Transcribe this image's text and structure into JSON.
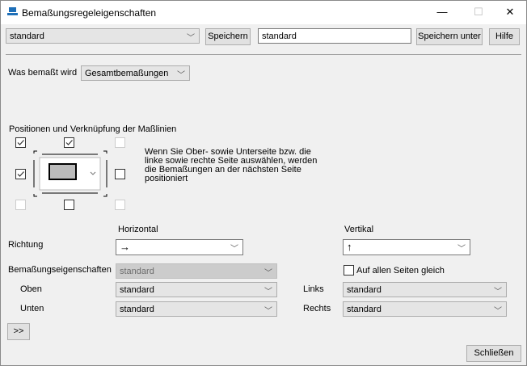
{
  "window": {
    "title": "Bemaßungsregeleigenschaften",
    "minimize": "—",
    "maximize": "☐",
    "close": "✕"
  },
  "top": {
    "preset": "standard",
    "save": "Speichern",
    "name_value": "standard",
    "save_as": "Speichern unter",
    "help": "Hilfe"
  },
  "what": {
    "label": "Was bemaßt wird",
    "value": "Gesamtbemaßungen"
  },
  "positions": {
    "label": "Positionen und Verknüpfung der Maßlinien",
    "hint": "Wenn Sie Ober- sowie Unterseite bzw. die linke sowie rechte Seite auswählen, werden die Bemaßungen an der nächsten Seite positioniert",
    "checks": {
      "top_left": true,
      "top": true,
      "top_right": false,
      "left": true,
      "right": false,
      "bottom_left": false,
      "bottom": false,
      "bottom_right": false
    }
  },
  "direction": {
    "horizontal_header": "Horizontal",
    "vertical_header": "Vertikal",
    "label": "Richtung",
    "horizontal_value": "→",
    "vertical_value": "↑"
  },
  "props": {
    "label": "Bemaßungseigenschaften",
    "value": "standard",
    "all_sides_label": "Auf allen Seiten gleich",
    "all_sides": false,
    "top_label": "Oben",
    "top_value": "standard",
    "bottom_label": "Unten",
    "bottom_value": "standard",
    "left_label": "Links",
    "left_value": "standard",
    "right_label": "Rechts",
    "right_value": "standard"
  },
  "expand": ">>",
  "close_button": "Schließen"
}
